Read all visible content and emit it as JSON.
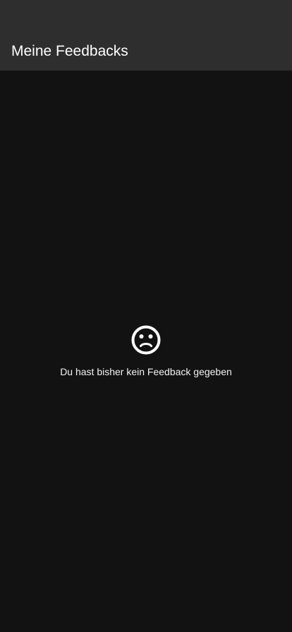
{
  "header": {
    "title": "Meine Feedbacks"
  },
  "empty_state": {
    "icon": "sad-face-icon",
    "message": "Du hast bisher kein Feedback gegeben"
  },
  "colors": {
    "background": "#121212",
    "app_bar": "#2e2e2e",
    "text": "#ffffff"
  }
}
